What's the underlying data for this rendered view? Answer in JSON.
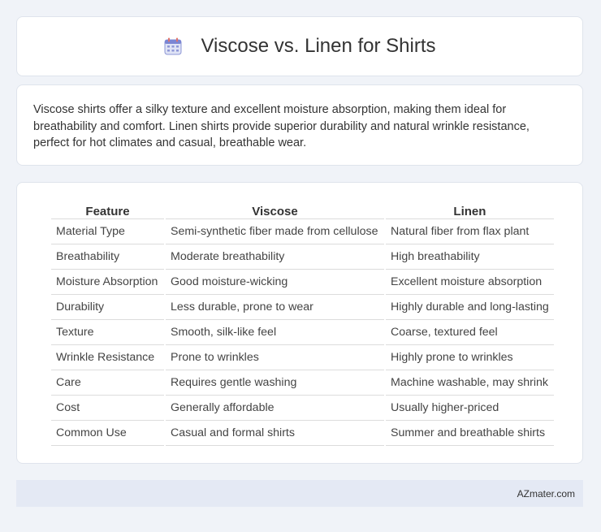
{
  "header": {
    "title": "Viscose vs. Linen for Shirts",
    "icon": "calendar-icon"
  },
  "summary": {
    "text": "Viscose shirts offer a silky texture and excellent moisture absorption, making them ideal for breathability and comfort. Linen shirts provide superior durability and natural wrinkle resistance, perfect for hot climates and casual, breathable wear."
  },
  "table": {
    "headers": [
      "Feature",
      "Viscose",
      "Linen"
    ],
    "rows": [
      [
        "Material Type",
        "Semi-synthetic fiber made from cellulose",
        "Natural fiber from flax plant"
      ],
      [
        "Breathability",
        "Moderate breathability",
        "High breathability"
      ],
      [
        "Moisture Absorption",
        "Good moisture-wicking",
        "Excellent moisture absorption"
      ],
      [
        "Durability",
        "Less durable, prone to wear",
        "Highly durable and long-lasting"
      ],
      [
        "Texture",
        "Smooth, silk-like feel",
        "Coarse, textured feel"
      ],
      [
        "Wrinkle Resistance",
        "Prone to wrinkles",
        "Highly prone to wrinkles"
      ],
      [
        "Care",
        "Requires gentle washing",
        "Machine washable, may shrink"
      ],
      [
        "Cost",
        "Generally affordable",
        "Usually higher-priced"
      ],
      [
        "Common Use",
        "Casual and formal shirts",
        "Summer and breathable shirts"
      ]
    ]
  },
  "footer": {
    "brand": "AZmater.com"
  }
}
